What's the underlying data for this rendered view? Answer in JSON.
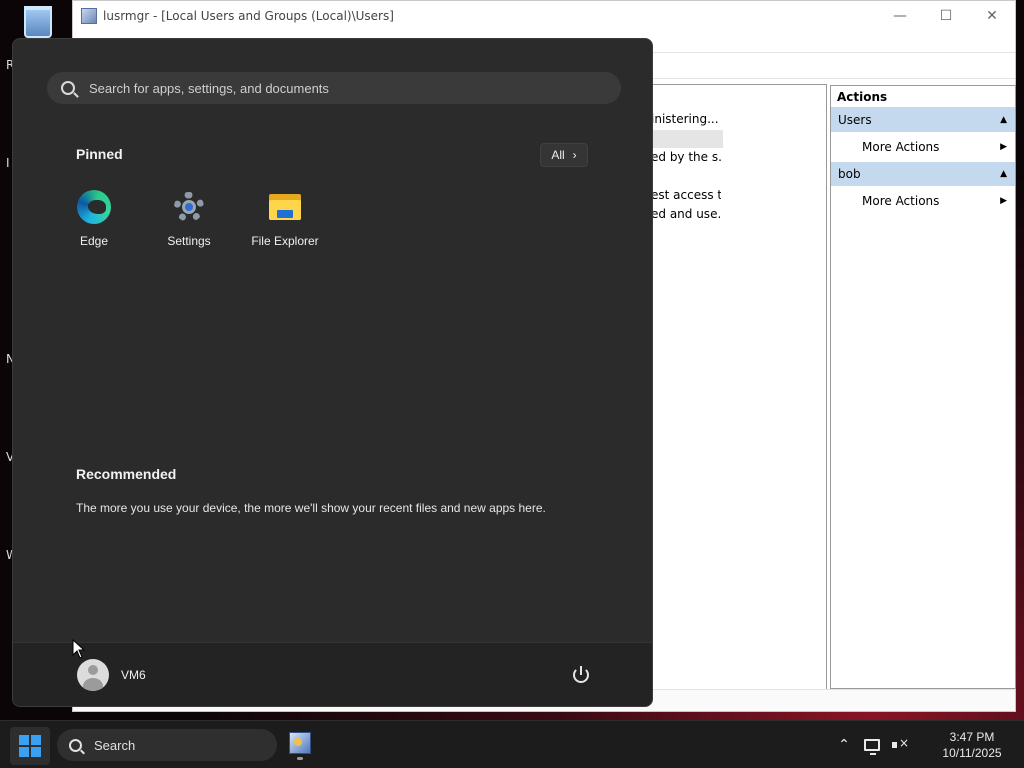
{
  "desktop": {
    "edge_letters": [
      "R",
      "I",
      "N",
      "V",
      "W"
    ]
  },
  "mmc_window": {
    "title": "lusrmgr - [Local Users and Groups (Local)\\Users]",
    "list_fragments": [
      "inistering...",
      "ed by the s...",
      "est access t...",
      "ed and use..."
    ],
    "actions": {
      "header": "Actions",
      "groups": [
        {
          "label": "Users",
          "item": "More Actions"
        },
        {
          "label": "bob",
          "item": "More Actions"
        }
      ]
    }
  },
  "start_menu": {
    "search_placeholder": "Search for apps, settings, and documents",
    "pinned_title": "Pinned",
    "all_button": "All",
    "pinned_apps": [
      {
        "label": "Edge",
        "icon": "edge-icon"
      },
      {
        "label": "Settings",
        "icon": "settings-gear-icon"
      },
      {
        "label": "File Explorer",
        "icon": "folder-icon"
      }
    ],
    "recommended_title": "Recommended",
    "recommended_text": "The more you use your device, the more we'll show your recent files and new apps here.",
    "user_name": "VM6"
  },
  "taskbar": {
    "search_label": "Search",
    "time": "3:47 PM",
    "date": "10/11/2025"
  },
  "colors": {
    "start_bg": "#2b2b2b",
    "taskbar_bg": "#1c1c1c",
    "accent": "#3aa0f2",
    "actions_group_bg": "#c5d9ee"
  }
}
